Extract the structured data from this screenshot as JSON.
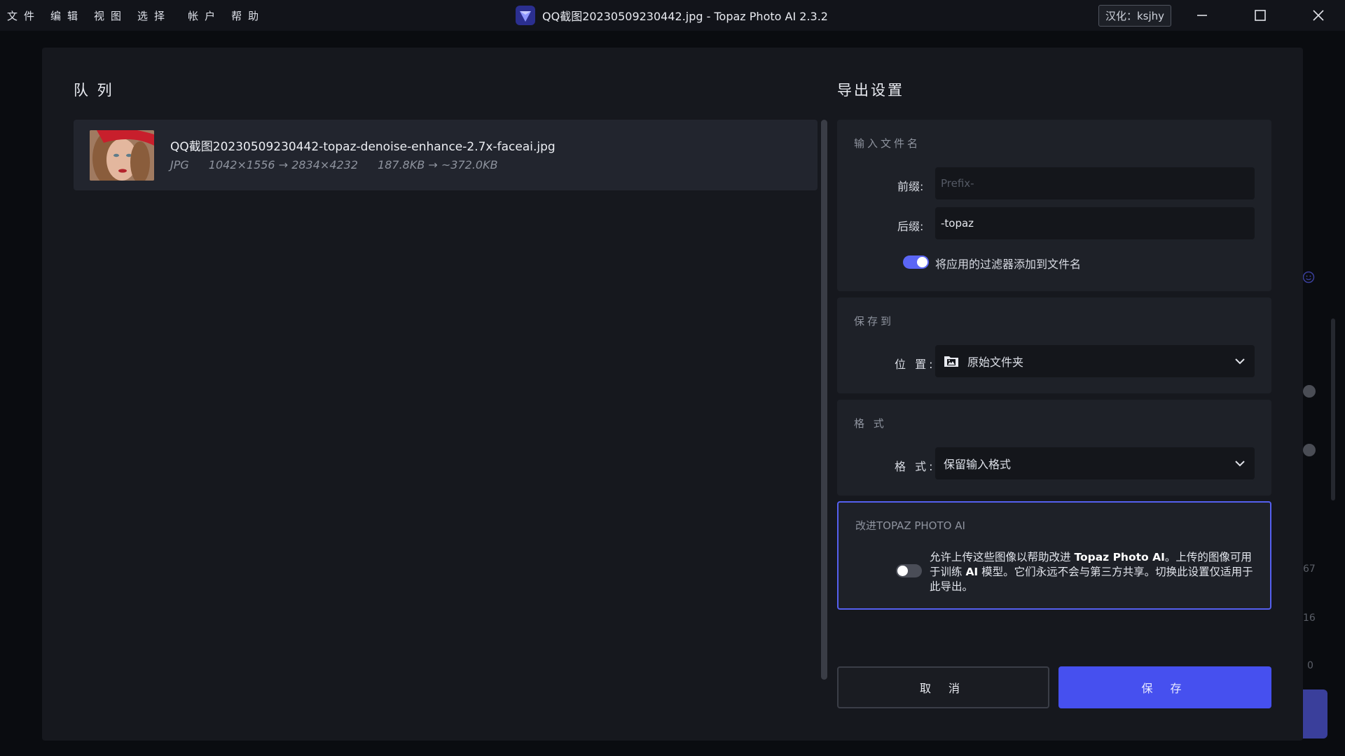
{
  "titlebar": {
    "menu": [
      "文件",
      "编辑",
      "视图",
      "选择",
      "帐户",
      "帮助"
    ],
    "title": "QQ截图20230509230442.jpg - Topaz Photo AI 2.3.2",
    "credit": "汉化：ksjhy",
    "window_controls": [
      "minimize-icon",
      "maximize-icon",
      "close-icon"
    ]
  },
  "background": {
    "numbers": [
      "67",
      "16",
      "0"
    ]
  },
  "queue": {
    "title": "队  列",
    "items": [
      {
        "filename": "QQ截图20230509230442-topaz-denoise-enhance-2.7x-faceai.jpg",
        "format": "JPG",
        "dimensions": "1042×1556 → 2834×4232",
        "size": "187.8KB → ~372.0KB"
      }
    ]
  },
  "export": {
    "title": "导出设置",
    "filename_section": {
      "label": "输入文件名",
      "prefix_label": "前缀:",
      "prefix_placeholder": "Prefix-",
      "prefix_value": "",
      "suffix_label": "后缀:",
      "suffix_value": "-topaz",
      "append_filters_label": "将应用的过滤器添加到文件名",
      "append_filters_on": true
    },
    "save_section": {
      "label": "保存到",
      "location_label": "位  置:",
      "location_value": "原始文件夹",
      "location_icon": "folder-image-icon"
    },
    "format_section": {
      "label": "格 式",
      "format_label": "格  式:",
      "format_value": "保留输入格式"
    },
    "improve_section": {
      "label": "改进TOPAZ PHOTO AI",
      "text_before": "允许上传这些图像以帮助改进 ",
      "text_bold1": "Topaz Photo AI",
      "text_mid": "。上传的图像可用于训练 ",
      "text_bold2": "AI",
      "text_after": " 模型。它们永远不会与第三方共享。切换此设置仅适用于此导出。",
      "toggle_on": false
    },
    "cancel_label": "取 消",
    "save_label": "保 存"
  },
  "colors": {
    "accent": "#4650ef",
    "focus_border": "#5560f0",
    "background": "#16181e"
  }
}
